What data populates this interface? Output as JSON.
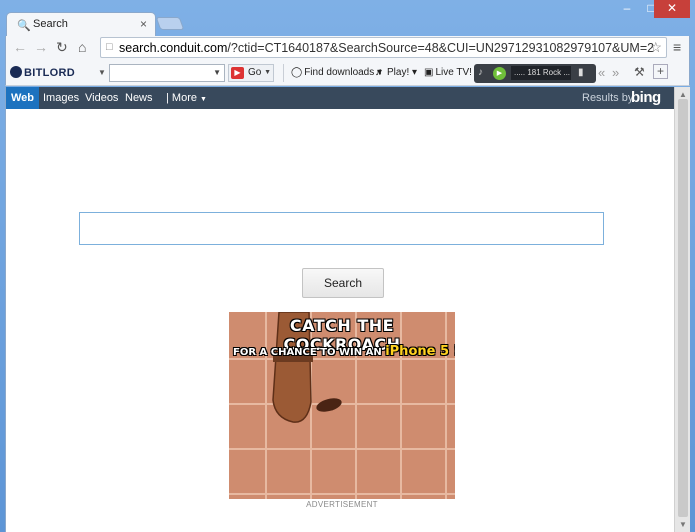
{
  "tab": {
    "title": "Search",
    "close": "×"
  },
  "window": {
    "min": "–",
    "max": "□",
    "close": "✕"
  },
  "address": {
    "host": "search.conduit.com",
    "path": "/?ctid=CT1640187&SearchSource=48&CUI=UN29712931082979107&UM=2"
  },
  "toolbar": {
    "brand": "BITLORD",
    "search_value": "",
    "go_label": "Go",
    "find_downloads": "Find downloads",
    "play": "Play!",
    "live_tv": "Live TV!",
    "radio_station": "..... 181 Rock ..."
  },
  "bing": {
    "tabs": [
      "Web",
      "Images",
      "Videos",
      "News",
      "| More"
    ],
    "results_by": "Results by",
    "logo": "bing"
  },
  "main": {
    "search_value": "",
    "search_button": "Search"
  },
  "ad": {
    "headline": "CATCH THE COCKROACH",
    "sub_text": "FOR A CHANCE TO WIN AN",
    "sub_highlight": "iPhone 5 !",
    "label": "ADVERTISEMENT"
  },
  "colors": {
    "bing_bar": "#38495c",
    "bing_active": "#1d72bf",
    "ad_tile": "#cf8c6f",
    "frame": "#6fa3dd"
  }
}
